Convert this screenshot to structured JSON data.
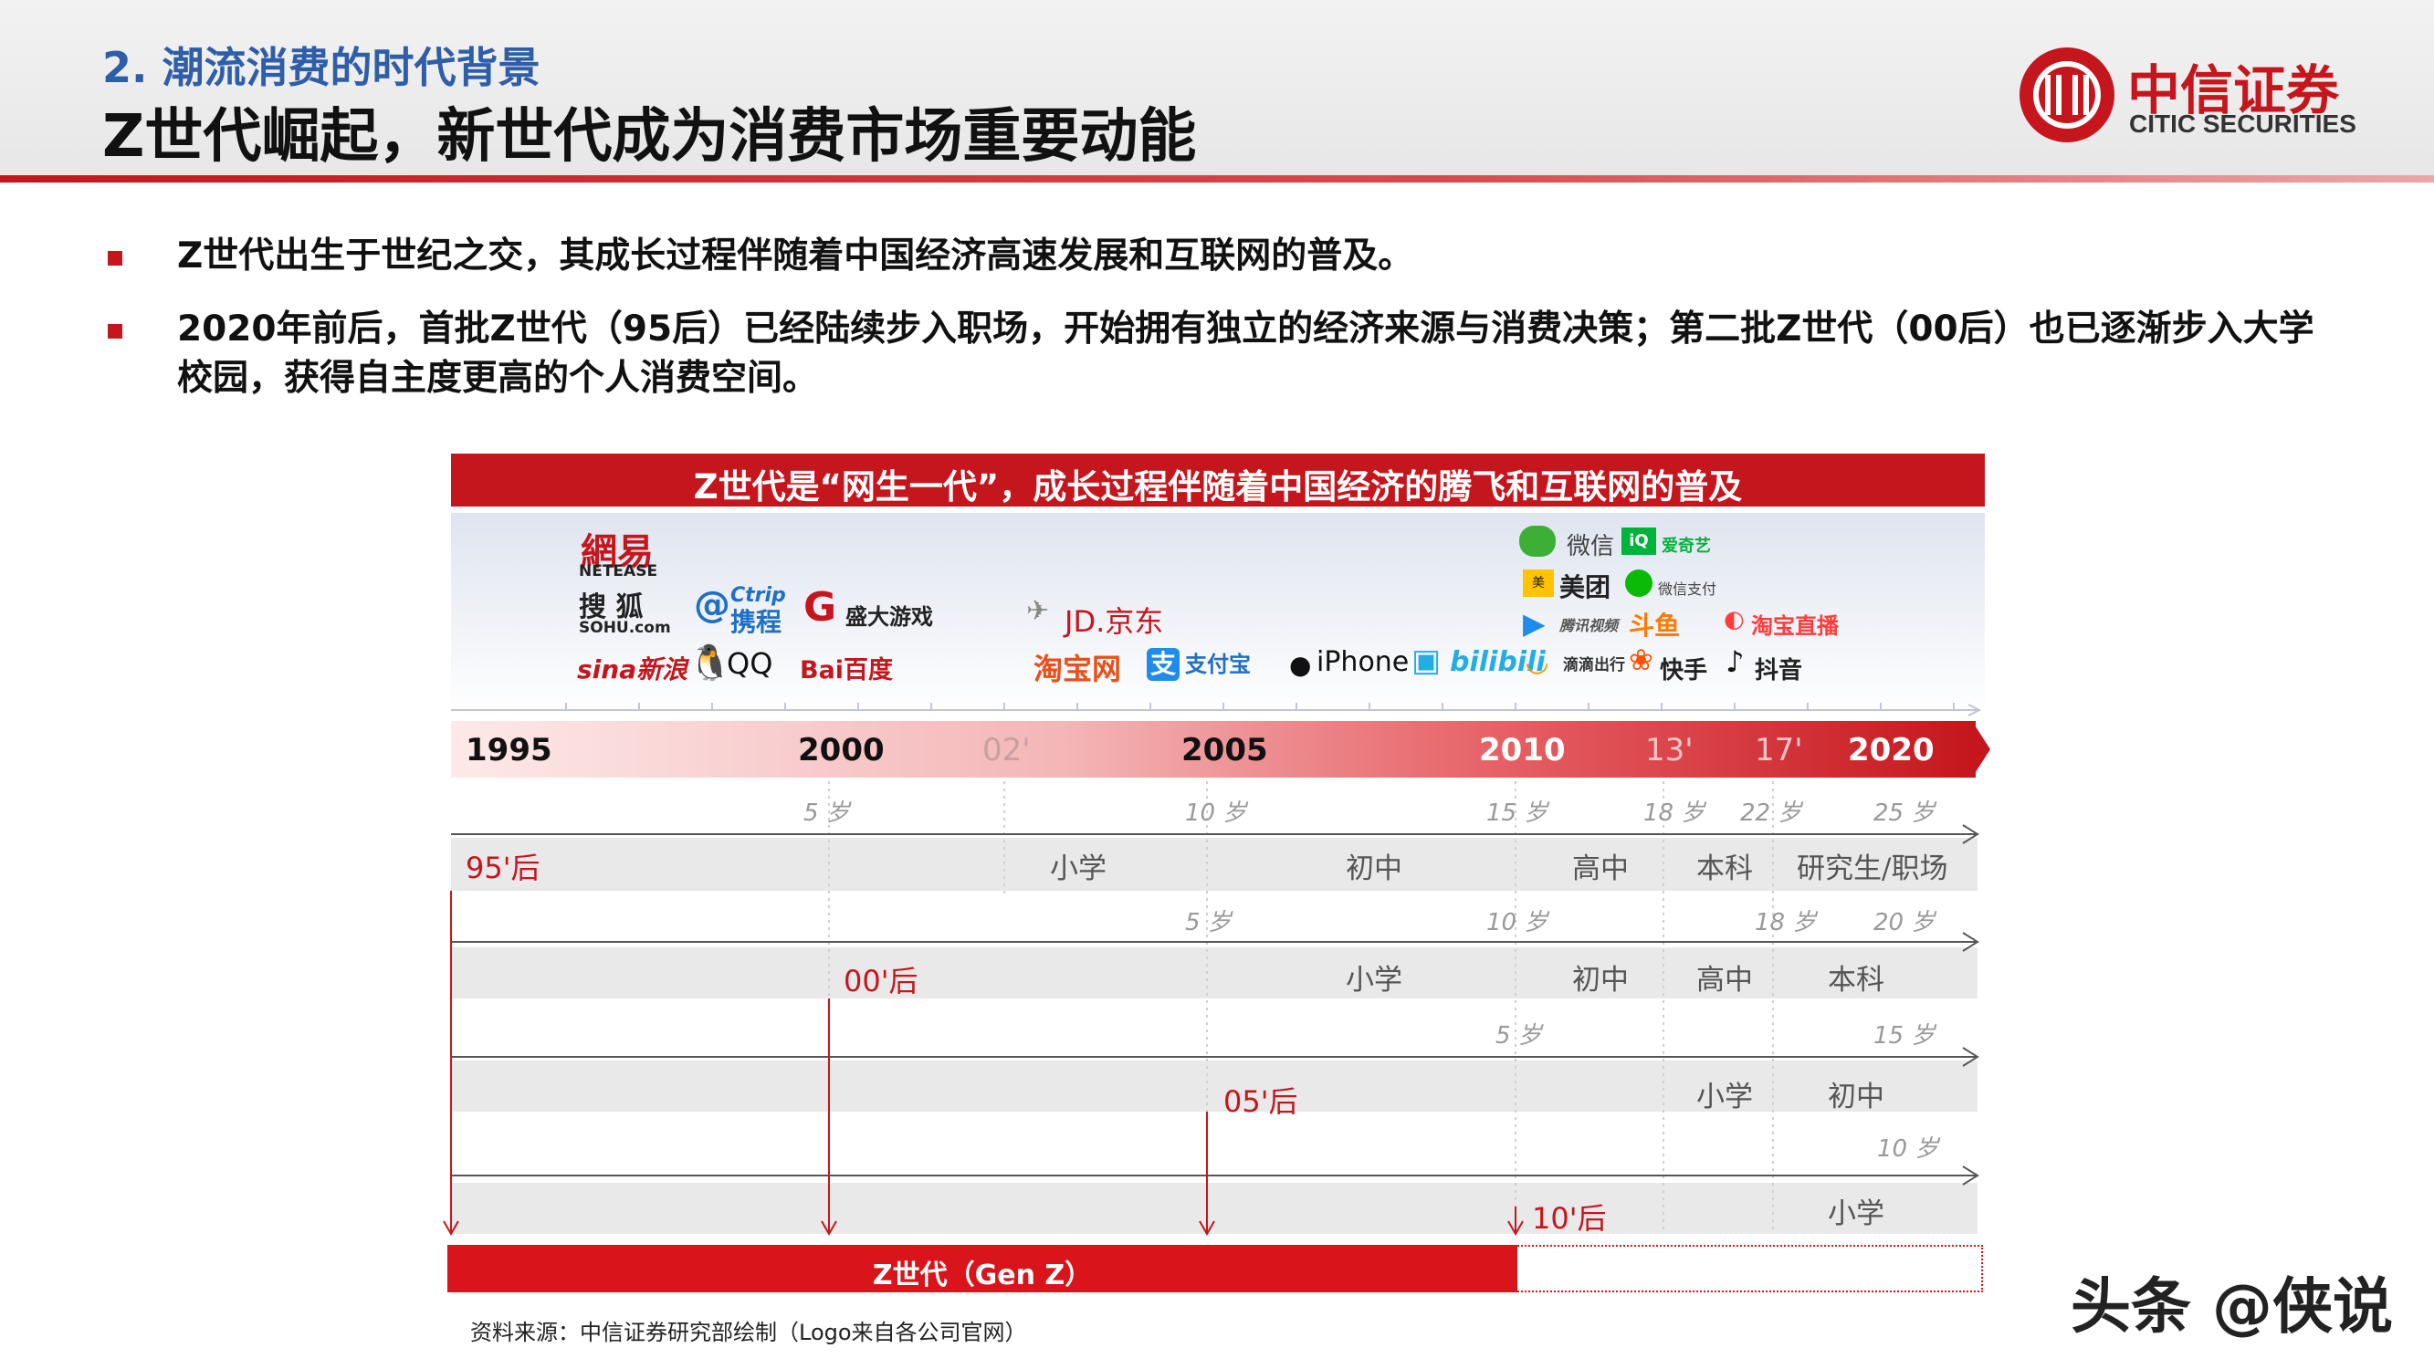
{
  "header": {
    "section_title": "2. 潮流消费的时代背景",
    "main_title": "Z世代崛起，新世代成为消费市场重要动能",
    "brand_cn": "中信证券",
    "brand_en": "CITIC SECURITIES"
  },
  "bullets": [
    "Z世代出生于世纪之交，其成长过程伴随着中国经济高速发展和互联网的普及。",
    "2020年前后，首批Z世代（95后）已经陆续步入职场，开始拥有独立的经济来源与消费决策；第二批Z世代（00后）也已逐渐步入大学校园，获得自主度更高的个人消费空间。"
  ],
  "figure": {
    "banner": "Z世代是“网生一代”，成长过程伴随着中国经济的腾飞和互联网的普及",
    "logos": {
      "netease_cn": "網易",
      "netease_en": "NETEASE",
      "sohu_cn": "搜 狐",
      "sohu_en": "SOHU.com",
      "sina": "sina新浪",
      "ctrip_en": "Ctrip",
      "ctrip_cn": "携程",
      "qq": "QQ",
      "shanda": "盛大游戏",
      "baidu": "Bai百度",
      "jd": "JD.京东",
      "taobao": "淘宝网",
      "alipay": "支付宝",
      "iphone": "iPhone",
      "bilibili": "bilibili",
      "didi": "滴滴出行",
      "kuaishou": "快手",
      "douyin": "抖音",
      "wechat": "微信",
      "iqiyi": "爱奇艺",
      "meituan": "美团",
      "wechatpay": "微信支付",
      "tencentvideo": "腾讯视频",
      "douyu": "斗鱼",
      "taobaolive": "淘宝直播"
    },
    "timeline": [
      "1995",
      "2000",
      "02'",
      "2005",
      "2010",
      "13'",
      "17'",
      "2020"
    ],
    "rows": [
      {
        "cohort": "95'后",
        "ages": [
          "5 岁",
          "10 岁",
          "15 岁",
          "18 岁",
          "22 岁",
          "25 岁"
        ],
        "stages": [
          "小学",
          "初中",
          "高中",
          "本科",
          "研究生/职场"
        ]
      },
      {
        "cohort": "00'后",
        "ages": [
          "5 岁",
          "10 岁",
          "18 岁",
          "20 岁"
        ],
        "stages": [
          "小学",
          "初中",
          "高中",
          "本科"
        ]
      },
      {
        "cohort": "05'后",
        "ages": [
          "5 岁",
          "15 岁"
        ],
        "stages": [
          "小学",
          "初中"
        ]
      },
      {
        "cohort": "10'后",
        "ages": [
          "10 岁"
        ],
        "stages": [
          "小学"
        ]
      }
    ],
    "genz_label": "Z世代（Gen Z）",
    "source": "资料来源：中信证券研究部绘制（Logo来自各公司官网）"
  },
  "watermark": "头条 @侠说",
  "colors": {
    "accent": "#c4161c",
    "title_blue": "#2e5ea8"
  }
}
